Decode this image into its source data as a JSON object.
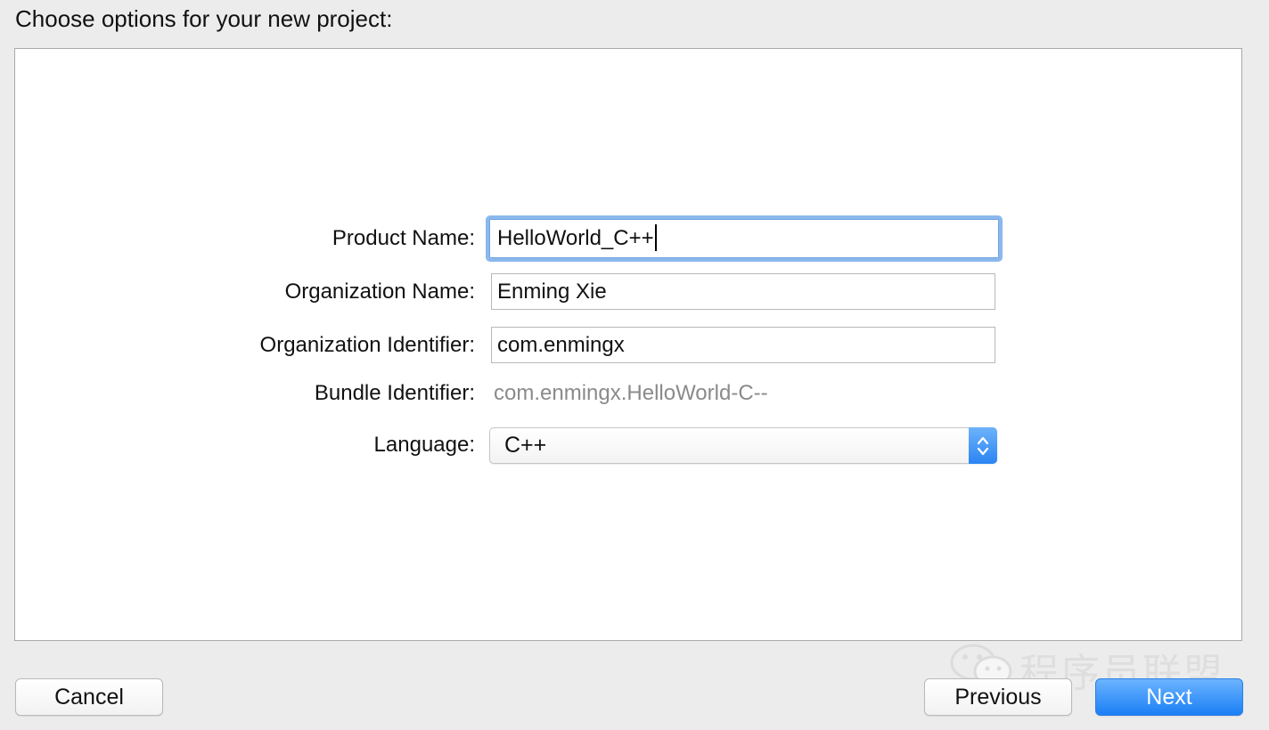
{
  "dialog": {
    "heading": "Choose options for your new project:"
  },
  "form": {
    "product_name": {
      "label": "Product Name:",
      "value": "HelloWorld_C++"
    },
    "organization_name": {
      "label": "Organization Name:",
      "value": "Enming Xie"
    },
    "organization_identifier": {
      "label": "Organization Identifier:",
      "value": "com.enmingx"
    },
    "bundle_identifier": {
      "label": "Bundle Identifier:",
      "value": "com.enmingx.HelloWorld-C--"
    },
    "language": {
      "label": "Language:",
      "value": "C++"
    }
  },
  "buttons": {
    "cancel": "Cancel",
    "previous": "Previous",
    "next": "Next"
  },
  "watermark": {
    "text": "程序员联盟",
    "icon": "wechat-icon"
  },
  "colors": {
    "accent": "#2b85f3",
    "focus_ring": "#8ab8ee",
    "background": "#ececec",
    "panel": "#ffffff",
    "muted_text": "#8a8a8a"
  }
}
